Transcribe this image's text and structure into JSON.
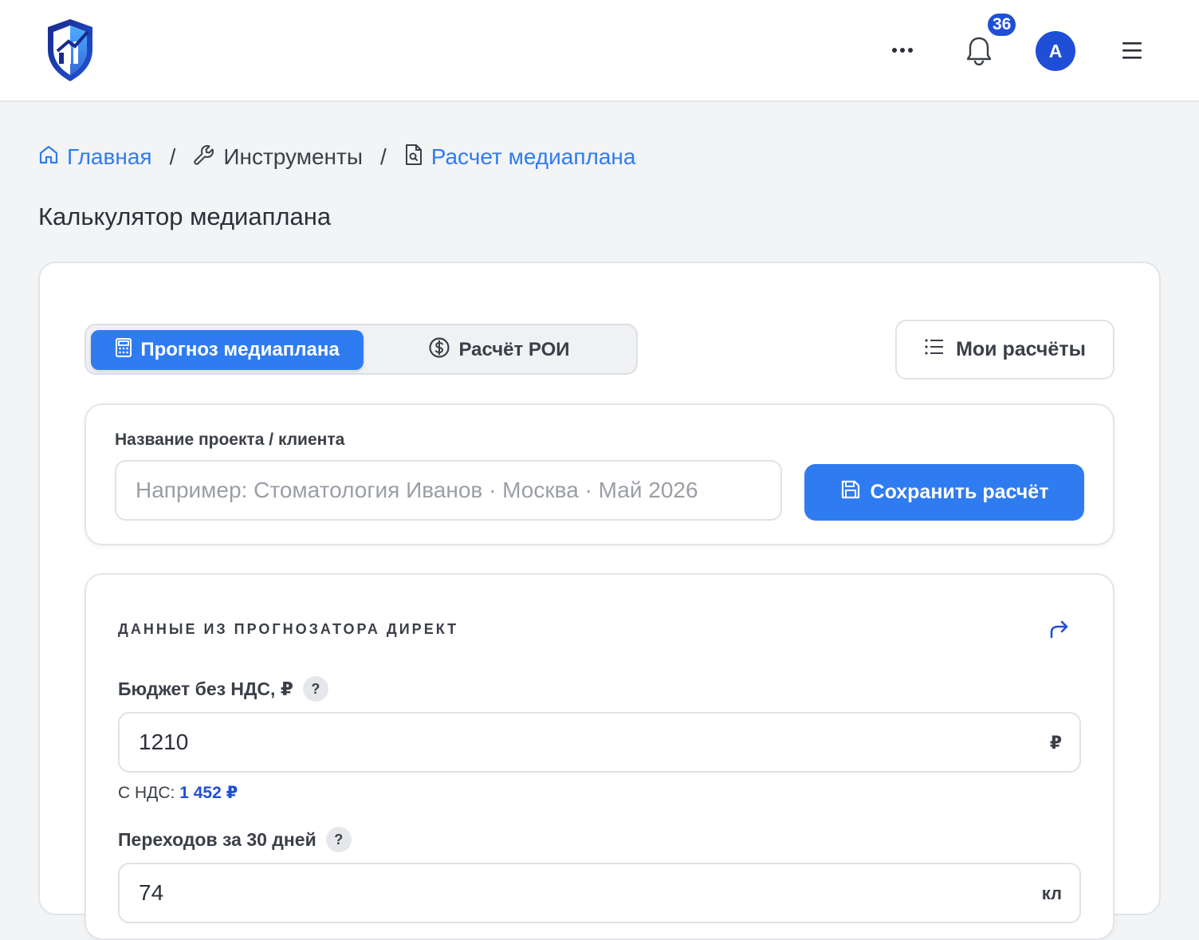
{
  "header": {
    "notifications_count": "36",
    "avatar_letter": "A"
  },
  "breadcrumb": {
    "home": "Главная",
    "tools": "Инструменты",
    "current": "Расчет медиаплана",
    "separator": "/"
  },
  "page_title": "Калькулятор медиаплана",
  "tabs": {
    "forecast": "Прогноз медиаплана",
    "roi": "Расчёт РОИ"
  },
  "my_calcs_label": "Мои расчёты",
  "project": {
    "label": "Название проекта / клиента",
    "placeholder": "Например: Стоматология Иванов · Москва · Май 2026",
    "value": "",
    "save_label": "Сохранить расчёт"
  },
  "direct_data": {
    "section_title": "ДАННЫЕ ИЗ ПРОГНОЗАТОРА ДИРЕКТ",
    "budget": {
      "label": "Бюджет без НДС, ₽",
      "value": "1210",
      "unit": "₽",
      "vat_label": "С НДС:",
      "vat_value": "1 452 ₽"
    },
    "clicks": {
      "label": "Переходов за 30 дней",
      "value": "74",
      "unit": "кл"
    }
  },
  "colors": {
    "accent": "#2f7cf0",
    "brand_dark": "#1f4fd6",
    "background": "#f3f4f6"
  }
}
